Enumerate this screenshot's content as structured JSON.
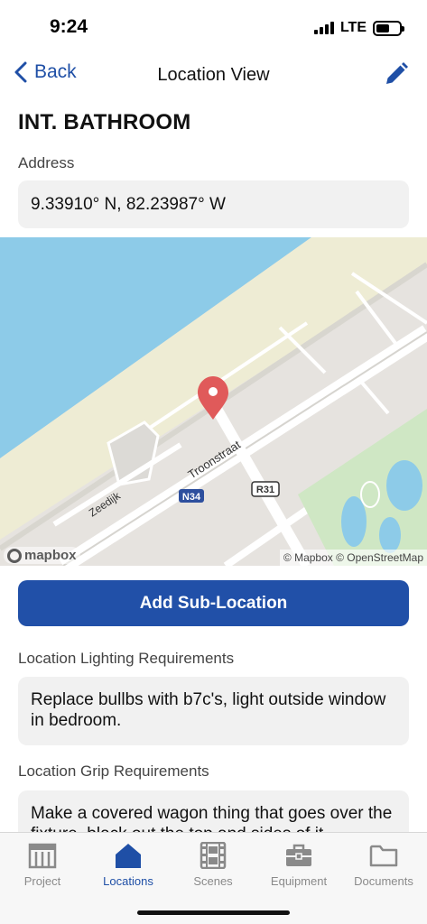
{
  "status_bar": {
    "time": "9:24",
    "network": "LTE"
  },
  "nav": {
    "back_label": "Back",
    "title": "Location View"
  },
  "location": {
    "name": "INT. BATHROOM",
    "address_label": "Address",
    "address_value": "9.33910° N, 82.23987° W"
  },
  "map": {
    "street_labels": [
      "Troonstraat",
      "Zeedijk",
      "N34",
      "R31"
    ],
    "logo_text": "mapbox",
    "attribution": "© Mapbox © OpenStreetMap",
    "colors": {
      "water": "#8dcbe8",
      "beach": "#eeecd4",
      "park": "#cfe7c4",
      "land": "#e6e3df",
      "pin": "#e05a5a"
    }
  },
  "add_sublocation_label": "Add Sub-Location",
  "lighting": {
    "label": "Location Lighting Requirements",
    "value": "Replace bullbs with b7c's, light outside window in bedroom."
  },
  "grip": {
    "label": "Location Grip Requirements",
    "value": "Make a covered wagon thing that goes over the fixture, black out the top and sides of it"
  },
  "tabs": [
    {
      "label": "Project",
      "icon": "building-icon",
      "active": false
    },
    {
      "label": "Locations",
      "icon": "home-icon",
      "active": true
    },
    {
      "label": "Scenes",
      "icon": "film-icon",
      "active": false
    },
    {
      "label": "Equipment",
      "icon": "toolbox-icon",
      "active": false
    },
    {
      "label": "Documents",
      "icon": "folder-icon",
      "active": false
    }
  ],
  "colors": {
    "accent": "#1f4fa6",
    "button": "#2150a8",
    "field_bg": "#f1f1f1"
  }
}
